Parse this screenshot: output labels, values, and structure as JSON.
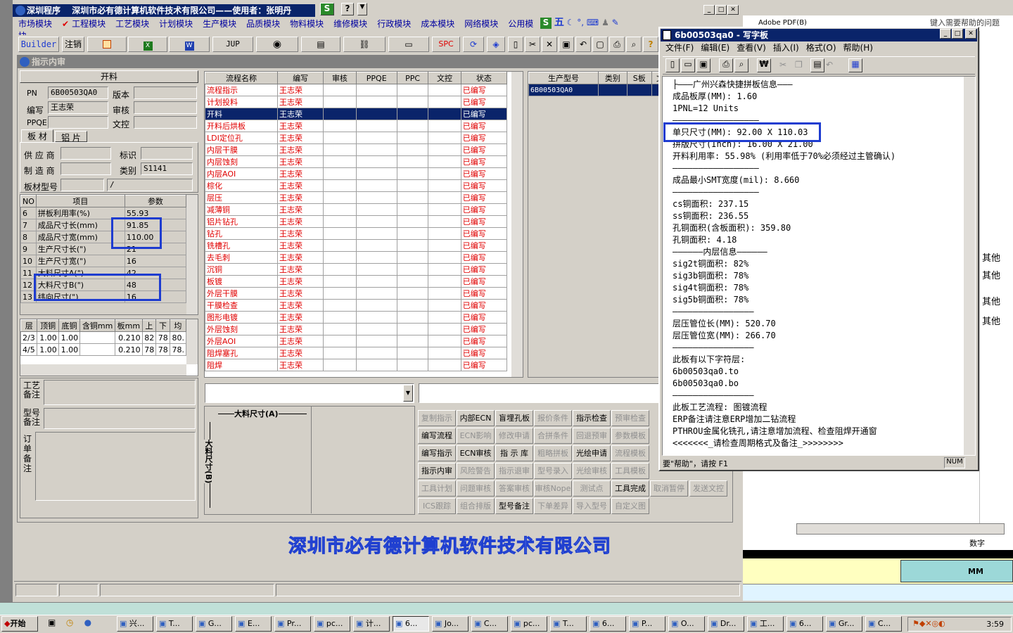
{
  "app": {
    "title": "深圳程序",
    "company_user": "深圳市必有德计算机软件技术有限公司——使用者：张明丹"
  },
  "menu": [
    "市场模块",
    "工程模块",
    "工艺模块",
    "计划模块",
    "生产模块",
    "品质模块",
    "物料模块",
    "维修模块",
    "行政模块",
    "成本模块",
    "网络模块",
    "公用模块"
  ],
  "toolbar": {
    "builder": "Builder",
    "logout": "注销",
    "jup": "JUP",
    "spc": "SPC"
  },
  "ime": {
    "mode": "五"
  },
  "inner_window": {
    "title": "指示内审"
  },
  "form": {
    "section": "开料",
    "pn_label": "PN",
    "pn": "6B00503QA0",
    "version_label": "版本",
    "editor_label": "编写",
    "editor": "王志荣",
    "review_label": "审核",
    "ppqe_label": "PPQE",
    "doc_label": "文控",
    "tab1": "板 材",
    "tab2": "铝 片",
    "supplier_label": "供 应 商",
    "mark_label": "标识",
    "maker_label": "制 造 商",
    "category_label": "类别",
    "category": "S1141",
    "board_model_label": "板材型号",
    "board_model2": "/"
  },
  "param_table": {
    "headers": [
      "NO",
      "项目",
      "参数"
    ],
    "rows": [
      [
        "6",
        "拼板利用率(%)",
        "55.93"
      ],
      [
        "7",
        "成品尺寸长(mm)",
        "91.85"
      ],
      [
        "8",
        "成品尺寸宽(mm)",
        "110.00"
      ],
      [
        "9",
        "生产尺寸长(\")",
        "21"
      ],
      [
        "10",
        "生产尺寸宽(\")",
        "16"
      ],
      [
        "11",
        "大料尺寸A(\")",
        "42"
      ],
      [
        "12",
        "大料尺寸B(\")",
        "48"
      ],
      [
        "13",
        "纬向尺寸(\")",
        "16"
      ]
    ]
  },
  "layer_table": {
    "headers": [
      "层",
      "顶铜",
      "底铜",
      "含铜mm",
      "板mm",
      "上",
      "下",
      "均"
    ],
    "rows": [
      [
        "2/3",
        "1.00",
        "1.00",
        "",
        "0.210",
        "82",
        "78",
        "80."
      ],
      [
        "4/5",
        "1.00",
        "1.00",
        "",
        "0.210",
        "78",
        "78",
        "78."
      ]
    ]
  },
  "remarks": {
    "craft": "工艺\n备注",
    "model": "型号\n备注",
    "order": "订\n单\n备\n注"
  },
  "flow_table": {
    "headers": [
      "流程名称",
      "编写",
      "审核",
      "PPQE",
      "PPC",
      "文控",
      "状态"
    ],
    "rows": [
      [
        "流程指示",
        "王志荣",
        "已编写"
      ],
      [
        "计划投料",
        "王志荣",
        "已编写"
      ],
      [
        "开料",
        "王志荣",
        "已编写"
      ],
      [
        "开料后烘板",
        "王志荣",
        "已编写"
      ],
      [
        "LDI定位孔",
        "王志荣",
        "已编写"
      ],
      [
        "内层干膜",
        "王志荣",
        "已编写"
      ],
      [
        "内层蚀刻",
        "王志荣",
        "已编写"
      ],
      [
        "内层AOI",
        "王志荣",
        "已编写"
      ],
      [
        "棕化",
        "王志荣",
        "已编写"
      ],
      [
        "层压",
        "王志荣",
        "已编写"
      ],
      [
        "减薄铜",
        "王志荣",
        "已编写"
      ],
      [
        "铝片钻孔",
        "王志荣",
        "已编写"
      ],
      [
        "钻孔",
        "王志荣",
        "已编写"
      ],
      [
        "铣槽孔",
        "王志荣",
        "已编写"
      ],
      [
        "去毛刺",
        "王志荣",
        "已编写"
      ],
      [
        "沉铜",
        "王志荣",
        "已编写"
      ],
      [
        "板镀",
        "王志荣",
        "已编写"
      ],
      [
        "外层干膜",
        "王志荣",
        "已编写"
      ],
      [
        "干膜检查",
        "王志荣",
        "已编写"
      ],
      [
        "图形电镀",
        "王志荣",
        "已编写"
      ],
      [
        "外层蚀刻",
        "王志荣",
        "已编写"
      ],
      [
        "外层AOI",
        "王志荣",
        "已编写"
      ],
      [
        "阻焊塞孔",
        "王志荣",
        "已编写"
      ],
      [
        "阻焊",
        "王志荣",
        "已编写"
      ]
    ],
    "selected_index": 2
  },
  "model_table": {
    "headers": [
      "生产型号",
      "类别",
      "S板",
      "文"
    ],
    "rows": [
      [
        "6B00503QA0"
      ]
    ]
  },
  "dimension": {
    "a": "大料尺寸(A)",
    "b": "大料尺寸(B)"
  },
  "action_buttons": [
    [
      "复制指示",
      "内部ECN",
      "盲埋孔板",
      "报价条件",
      "指示检查",
      "预审检查"
    ],
    [
      "编写流程",
      "ECN影响",
      "修改申请",
      "合拼条件",
      "回退预审",
      "参数模板"
    ],
    [
      "编写指示",
      "ECN审核",
      "指 示 库",
      "粗略拼板",
      "光绘申请",
      "流程模板"
    ],
    [
      "指示内审",
      "风险警告",
      "指示退审",
      "型号录入",
      "光绘审核",
      "工具模板"
    ],
    [
      "工具计划",
      "问题审核",
      "答案审核",
      "审核Nope",
      "测试点",
      "工具完成"
    ],
    [
      "ICS跟踪",
      "组合排版",
      "型号备注",
      "下单差异",
      "导入型号",
      "自定义图"
    ]
  ],
  "action_enabled": [
    [
      false,
      true,
      true,
      false,
      true,
      false
    ],
    [
      true,
      false,
      false,
      false,
      false,
      false
    ],
    [
      true,
      true,
      true,
      false,
      true,
      false
    ],
    [
      true,
      false,
      false,
      false,
      false,
      false
    ],
    [
      false,
      false,
      false,
      false,
      false,
      true
    ],
    [
      false,
      false,
      true,
      false,
      false,
      false
    ]
  ],
  "extra_buttons": [
    "取消暂停",
    "发送文控"
  ],
  "banner": "深圳市必有德计算机软件技术有限公司",
  "wordpad": {
    "title": "6b00503qa0 - 写字板",
    "menu": [
      "文件(F)",
      "编辑(E)",
      "查看(V)",
      "插入(I)",
      "格式(O)",
      "帮助(H)"
    ],
    "status": "要\"帮助\"，请按 F1",
    "num": "NUM",
    "lines": [
      "├———广州兴森快捷拼板信息———",
      "成品板厚(MM): 1.60",
      "1PNL=12 Units",
      "—————————————————",
      "单只尺寸(MM): 92.00 X 110.03",
      "拼版尺寸(Inch): 16.00 X 21.00",
      "开料利用率: 55.98% (利用率低于70%必须经过主管确认)",
      "—————————————————",
      "成品最小SMT宽度(mil): 8.660",
      "—————————————————",
      "cs铜面积: 237.15",
      "ss铜面积: 236.55",
      "孔铜面积(含板面积): 359.80",
      "孔铜面积: 4.18",
      "——————内层信息——————",
      "sig2t铜面积: 82%",
      "sig3b铜面积: 78%",
      "sig4t铜面积: 78%",
      "sig5b铜面积: 78%",
      "————————————————",
      "层压管位长(MM): 520.70",
      "层压管位宽(MM): 266.70",
      "————————————————",
      "此板有以下字符层:",
      "6b00503qa0.to",
      "6b00503qa0.bo",
      "————————————————",
      "此板工艺流程: 图镀流程",
      "ERP备注请注意ERP增加二钻流程",
      "PTHROU金属化铣孔,请注意增加流程、检查阻焊开通窗",
      "<<<<<<<_请检查周期格式及备注_>>>>>>>>"
    ]
  },
  "background_app": {
    "pdf": "Adobe PDF(B)",
    "help": "键入需要帮助的问题",
    "other": "其他",
    "digital": "数字",
    "mm": "MM"
  },
  "taskbar": {
    "start": "开始",
    "items": [
      "兴...",
      "T...",
      "G...",
      "E...",
      "Pr...",
      "pc...",
      "计...",
      "6...",
      "Jo...",
      "C...",
      "pc...",
      "T...",
      "6...",
      "P...",
      "O...",
      "Dr...",
      "工...",
      "6...",
      "Gr...",
      "C..."
    ],
    "clock": "3:59"
  }
}
